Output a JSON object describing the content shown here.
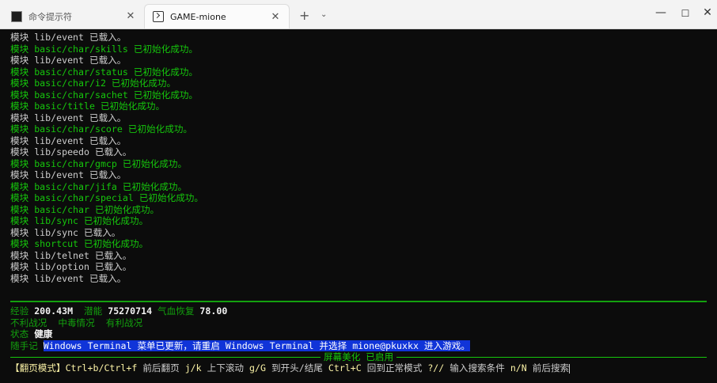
{
  "window": {
    "tabs": [
      {
        "label": "命令提示符",
        "icon": "cmd-icon"
      },
      {
        "label": "GAME-mione",
        "icon": "terminal-icon"
      }
    ],
    "new_tab": "+",
    "dropdown": "⌄",
    "controls": {
      "minimize": "—",
      "maximize": "☐",
      "close": "✕"
    }
  },
  "log": [
    {
      "prefix": "模块",
      "name": "lib/event",
      "msg": "已载入。",
      "success": false
    },
    {
      "prefix": "模块",
      "name": "basic/char/skills",
      "msg": "已初始化成功。",
      "success": true
    },
    {
      "prefix": "模块",
      "name": "lib/event",
      "msg": "已载入。",
      "success": false
    },
    {
      "prefix": "模块",
      "name": "basic/char/status",
      "msg": "已初始化成功。",
      "success": true
    },
    {
      "prefix": "模块",
      "name": "basic/char/i2",
      "msg": "已初始化成功。",
      "success": true
    },
    {
      "prefix": "模块",
      "name": "basic/char/sachet",
      "msg": "已初始化成功。",
      "success": true
    },
    {
      "prefix": "模块",
      "name": "basic/title",
      "msg": "已初始化成功。",
      "success": true
    },
    {
      "prefix": "模块",
      "name": "lib/event",
      "msg": "已载入。",
      "success": false
    },
    {
      "prefix": "模块",
      "name": "basic/char/score",
      "msg": "已初始化成功。",
      "success": true
    },
    {
      "prefix": "模块",
      "name": "lib/event",
      "msg": "已载入。",
      "success": false
    },
    {
      "prefix": "模块",
      "name": "lib/speedo",
      "msg": "已载入。",
      "success": false
    },
    {
      "prefix": "模块",
      "name": "basic/char/gmcp",
      "msg": "已初始化成功。",
      "success": true
    },
    {
      "prefix": "模块",
      "name": "lib/event",
      "msg": "已载入。",
      "success": false
    },
    {
      "prefix": "模块",
      "name": "basic/char/jifa",
      "msg": "已初始化成功。",
      "success": true
    },
    {
      "prefix": "模块",
      "name": "basic/char/special",
      "msg": "已初始化成功。",
      "success": true
    },
    {
      "prefix": "模块",
      "name": "basic/char",
      "msg": "已初始化成功。",
      "success": true
    },
    {
      "prefix": "模块",
      "name": "lib/sync",
      "msg": "已初始化成功。",
      "success": true
    },
    {
      "prefix": "模块",
      "name": "lib/sync",
      "msg": "已载入。",
      "success": false
    },
    {
      "prefix": "模块",
      "name": "shortcut",
      "msg": "已初始化成功。",
      "success": true
    },
    {
      "prefix": "模块",
      "name": "lib/telnet",
      "msg": "已载入。",
      "success": false
    },
    {
      "prefix": "模块",
      "name": "lib/option",
      "msg": "已载入。",
      "success": false
    },
    {
      "prefix": "模块",
      "name": "lib/event",
      "msg": "已载入。",
      "success": false
    }
  ],
  "status": {
    "exp_label": "经验",
    "exp_value": "200.43M",
    "pot_label": "潜能",
    "pot_value": "75270714",
    "hp_label": "气血恢复",
    "hp_value": "78.00",
    "cond1": "不利战况",
    "cond2": "中毒情况",
    "cond3": "有利战况",
    "state_label": "状态",
    "state_value": "健康",
    "note_label": "随手记",
    "note_text": "Windows Terminal 菜单已更新，请重启 Windows Terminal 并选择 mione@pkuxkx 进入游戏。"
  },
  "separator_text": "屏幕美化 已启用",
  "help": {
    "mode": "【翻页模式】",
    "k1": "Ctrl+b/Ctrl+f",
    "d1": "前后翻页",
    "k2": "j/k",
    "d2": "上下滚动",
    "k3": "g/G",
    "d3": "到开头/结尾",
    "k4": "Ctrl+C",
    "d4": "回到正常模式",
    "k5": "?//",
    "d5": "输入搜索条件",
    "k6": "n/N",
    "d6": "前后搜索"
  },
  "colors": {
    "background": "#0c0c0c",
    "text": "#cccccc",
    "success": "#16c60c",
    "label": "#13a10e",
    "highlight": "#1034d8",
    "key": "#f9f1a5"
  }
}
